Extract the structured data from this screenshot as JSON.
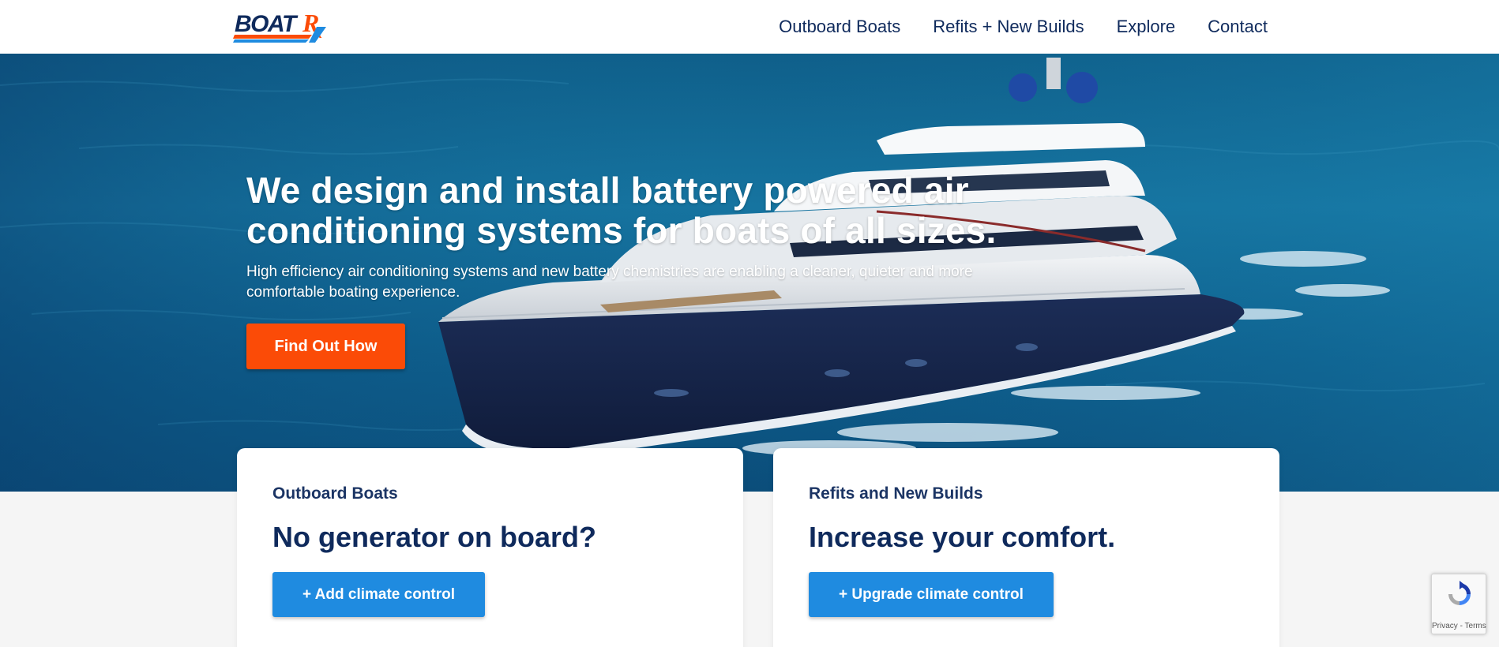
{
  "brand": {
    "logo_text": "BOATRx",
    "accent_orange": "#fb4b07",
    "accent_blue": "#1f8be0",
    "navy": "#0f2a5c"
  },
  "nav": {
    "items": [
      "Outboard Boats",
      "Refits + New Builds",
      "Explore",
      "Contact"
    ]
  },
  "hero": {
    "title_line1": "We design and install battery powered air",
    "title_line2": "conditioning systems for boats of all sizes.",
    "subtitle": "High efficiency air conditioning systems and new battery chemistries are enabling a cleaner, quieter and more comfortable boating experience.",
    "cta_label": "Find Out How",
    "background": "yacht-on-ocean-image"
  },
  "cards": [
    {
      "eyebrow": "Outboard Boats",
      "title": "No generator on board?",
      "button_label": "+ Add climate control"
    },
    {
      "eyebrow": "Refits and New Builds",
      "title": "Increase your comfort.",
      "button_label": "+ Upgrade climate control"
    }
  ],
  "recaptcha": {
    "privacy": "Privacy",
    "separator": " - ",
    "terms": "Terms"
  }
}
